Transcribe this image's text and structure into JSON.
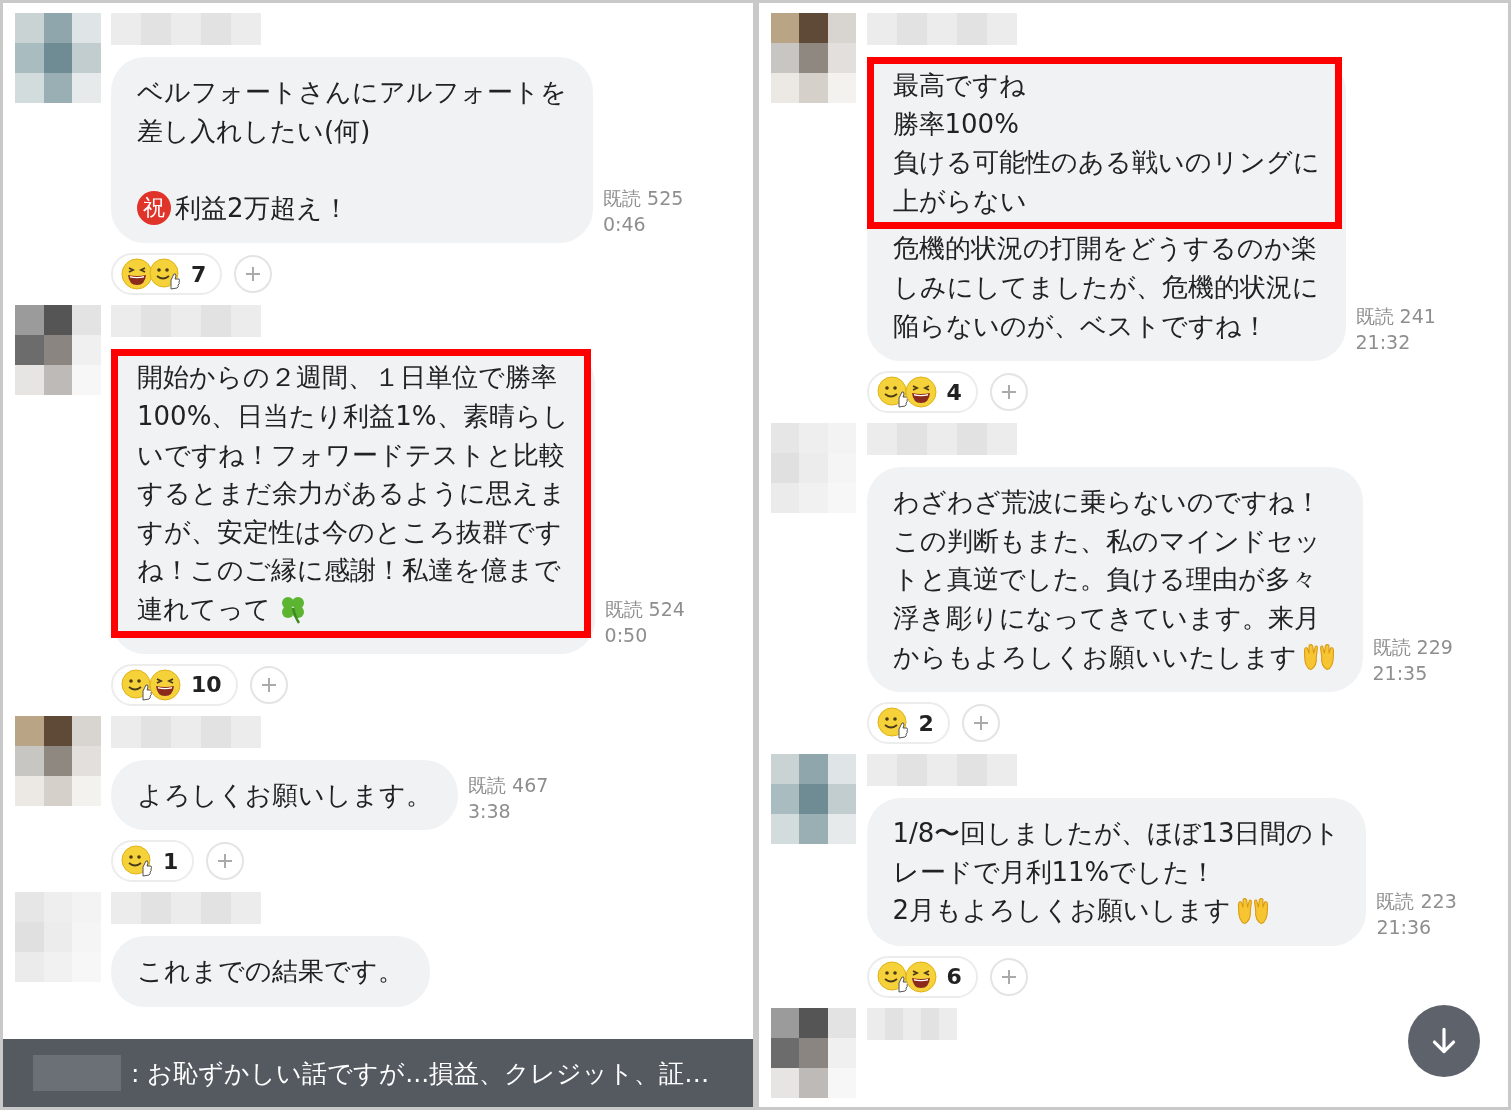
{
  "panels": [
    {
      "messages": [
        {
          "lines": [
            {
              "kind": "plain",
              "text": "ベルフォートさんにアルフォートを",
              "highlighted": false
            },
            {
              "kind": "plain",
              "text": "差し入れしたい(何)",
              "highlighted": false
            },
            {
              "kind": "gap",
              "highlighted": false
            },
            {
              "kind": "badge",
              "badge": "祝",
              "text": "利益2万超え！",
              "highlighted": false
            }
          ],
          "read": "既読 525",
          "time": "0:46",
          "reaction": {
            "faces": [
              {
                "kind": "laugh"
              },
              {
                "kind": "thumb"
              }
            ],
            "count": "7"
          }
        },
        {
          "lines": [
            {
              "kind": "plain",
              "text": "開始からの２週間、１日単位で勝率",
              "highlighted": true
            },
            {
              "kind": "plain",
              "text": "100%、日当たり利益1%、素晴らし",
              "highlighted": true
            },
            {
              "kind": "plain",
              "text": "いですね！フォワードテストと比較",
              "highlighted": true
            },
            {
              "kind": "plain",
              "text": "するとまだ余力があるように思えま",
              "highlighted": true
            },
            {
              "kind": "plain",
              "text": "すが、安定性は今のところ抜群です",
              "highlighted": true
            },
            {
              "kind": "plain",
              "text": "ね！このご縁に感謝！私達を億まで",
              "highlighted": true
            },
            {
              "kind": "clover",
              "text": "連れてって",
              "highlighted": true
            }
          ],
          "read": "既読 524",
          "time": "0:50",
          "reaction": {
            "faces": [
              {
                "kind": "thumb"
              },
              {
                "kind": "laugh"
              }
            ],
            "count": "10"
          }
        },
        {
          "lines": [
            {
              "kind": "plain",
              "text": "よろしくお願いします。",
              "highlighted": false
            }
          ],
          "read": "既読 467",
          "time": "3:38",
          "reaction": {
            "faces": [
              {
                "kind": "thumb"
              }
            ],
            "count": "1"
          }
        },
        {
          "lines": [
            {
              "kind": "plain",
              "text": "これまでの結果です。",
              "highlighted": false
            }
          ]
        }
      ],
      "banner": {
        "text": ": お恥ずかしい話ですが...損益、クレジット、証…"
      }
    },
    {
      "messages": [
        {
          "lines": [
            {
              "kind": "plain",
              "text": "最高ですね",
              "highlighted": true
            },
            {
              "kind": "plain",
              "text": "勝率100%",
              "highlighted": true
            },
            {
              "kind": "plain",
              "text": "負ける可能性のある戦いのリングに",
              "highlighted": true
            },
            {
              "kind": "plain",
              "text": "上がらない",
              "highlighted": true
            },
            {
              "kind": "plain",
              "text": "危機的状況の打開をどうするのか楽",
              "highlighted": false
            },
            {
              "kind": "plain",
              "text": "しみにしてましたが、危機的状況に",
              "highlighted": false
            },
            {
              "kind": "plain",
              "text": "陥らないのが、ベストですね！",
              "highlighted": false
            }
          ],
          "read": "既読 241",
          "time": "21:32",
          "reaction": {
            "faces": [
              {
                "kind": "thumb"
              },
              {
                "kind": "laugh"
              }
            ],
            "count": "4"
          }
        },
        {
          "lines": [
            {
              "kind": "plain",
              "text": "わざわざ荒波に乗らないのですね！",
              "highlighted": false
            },
            {
              "kind": "plain",
              "text": "この判断もまた、私のマインドセッ",
              "highlighted": false
            },
            {
              "kind": "plain",
              "text": "トと真逆でした。負ける理由が多々",
              "highlighted": false
            },
            {
              "kind": "plain",
              "text": "浮き彫りになってきています。来月",
              "highlighted": false
            },
            {
              "kind": "hands",
              "text": "からもよろしくお願いいたします",
              "highlighted": false
            }
          ],
          "read": "既読 229",
          "time": "21:35",
          "reaction": {
            "faces": [
              {
                "kind": "thumb"
              }
            ],
            "count": "2"
          }
        },
        {
          "lines": [
            {
              "kind": "plain",
              "text": "1/8〜回しましたが、ほぼ13日間のト",
              "highlighted": false
            },
            {
              "kind": "plain",
              "text": "レードで月利11%でした！",
              "highlighted": false
            },
            {
              "kind": "hands",
              "text": "2月もよろしくお願いします",
              "highlighted": false
            }
          ],
          "read": "既読 223",
          "time": "21:36",
          "reaction": {
            "faces": [
              {
                "kind": "thumb"
              },
              {
                "kind": "laugh"
              }
            ],
            "count": "6"
          }
        },
        {
          "cut_off": true
        }
      ],
      "scroll_button": true
    }
  ]
}
